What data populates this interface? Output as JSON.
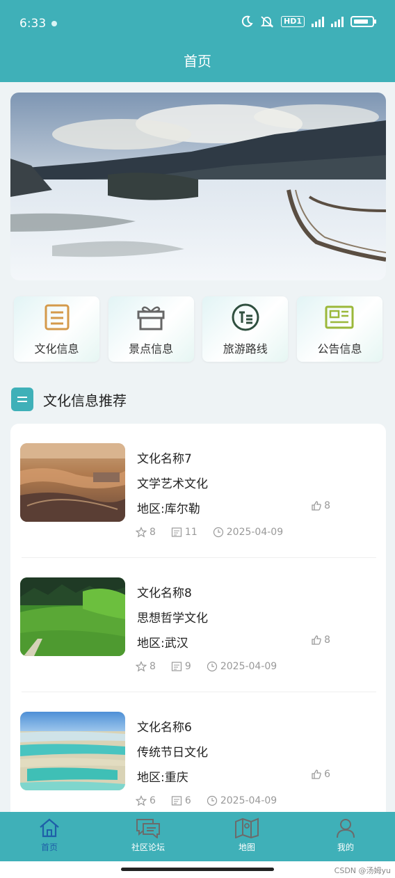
{
  "status": {
    "time": "6:33",
    "hd": "HD1"
  },
  "title": "首页",
  "quick_links": [
    {
      "label": "文化信息",
      "icon": "document-list-icon",
      "color": "#d49a4b"
    },
    {
      "label": "景点信息",
      "icon": "gift-icon",
      "color": "#666666"
    },
    {
      "label": "旅游路线",
      "icon": "route-list-icon",
      "color": "#2f4f3f"
    },
    {
      "label": "公告信息",
      "icon": "notice-card-icon",
      "color": "#9bb83a"
    }
  ],
  "section": {
    "title": "文化信息推荐"
  },
  "items": [
    {
      "name": "文化名称7",
      "category": "文学艺术文化",
      "region": "地区:库尔勒",
      "likes": "8",
      "favorites": "8",
      "views": "11",
      "date": "2025-04-09"
    },
    {
      "name": "文化名称8",
      "category": "思想哲学文化",
      "region": "地区:武汉",
      "likes": "8",
      "favorites": "8",
      "views": "9",
      "date": "2025-04-09"
    },
    {
      "name": "文化名称6",
      "category": "传统节日文化",
      "region": "地区:重庆",
      "likes": "6",
      "favorites": "6",
      "views": "6",
      "date": "2025-04-09"
    }
  ],
  "tabs": [
    {
      "label": "首页",
      "icon": "home-icon"
    },
    {
      "label": "社区论坛",
      "icon": "chat-icon"
    },
    {
      "label": "地图",
      "icon": "map-icon"
    },
    {
      "label": "我的",
      "icon": "user-icon"
    }
  ],
  "watermark": "CSDN @汤姆yu",
  "colors": {
    "primary": "#3fb0b8",
    "active_tab": "#1e5fa8"
  }
}
